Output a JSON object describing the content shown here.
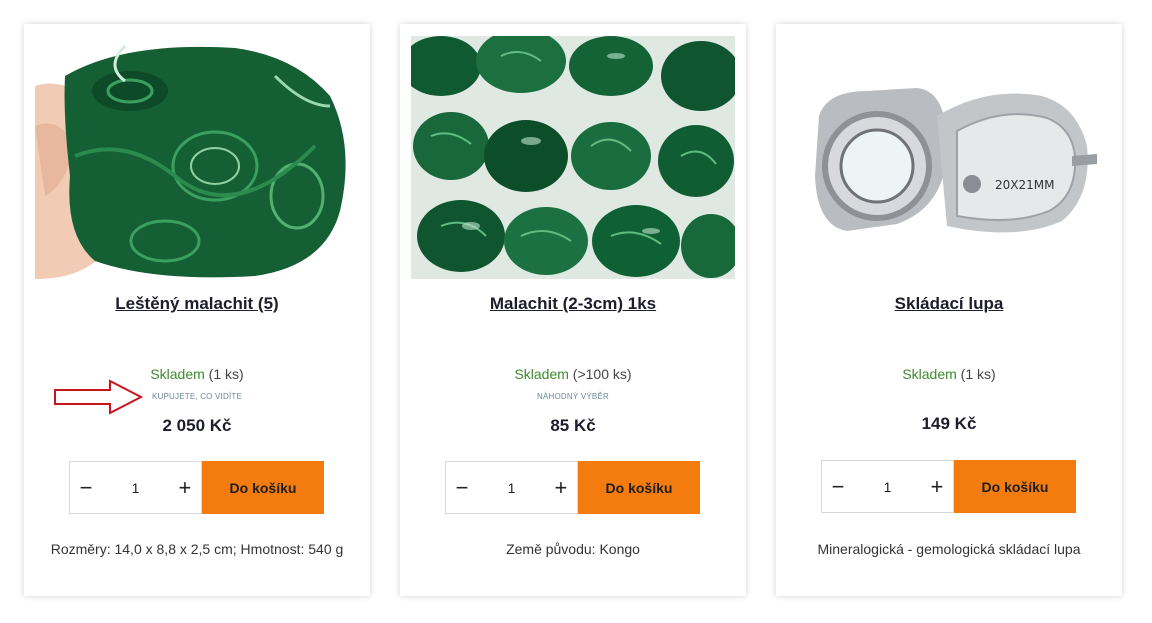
{
  "products": [
    {
      "title": "Leštěný malachit (5)",
      "stock_status": "Skladem",
      "stock_qty": "(1 ks)",
      "note": "KUPUJETE, CO VIDÍTE",
      "price": "2 050 Kč",
      "quantity": "1",
      "add_label": "Do košíku",
      "desc": "Rozměry: 14,0 x 8,8 x 2,5 cm; Hmotnost: 540 g",
      "image": "polished-malachite-in-hand"
    },
    {
      "title": "Malachit (2-3cm) 1ks",
      "stock_status": "Skladem",
      "stock_qty": "(>100 ks)",
      "note": "NÁHODNÝ VÝBĚR",
      "price": "85 Kč",
      "quantity": "1",
      "add_label": "Do košíku",
      "desc": "Země původu: Kongo",
      "image": "tumbled-malachite-stones"
    },
    {
      "title": "Skládací lupa",
      "stock_status": "Skladem",
      "stock_qty": "(1 ks)",
      "note": "",
      "price": "149 Kč",
      "quantity": "1",
      "add_label": "Do košíku",
      "desc": "Mineralogická - gemologická skládací lupa",
      "image": "folding-loupe",
      "image_text": "20X21MM"
    }
  ],
  "controls": {
    "minus": "−",
    "plus": "+"
  },
  "colors": {
    "accent": "#f47c0e",
    "stock_green": "#3d8a2e",
    "annotation_red": "#c8161d"
  },
  "icons": {
    "annotation": "red-arrow-icon"
  }
}
